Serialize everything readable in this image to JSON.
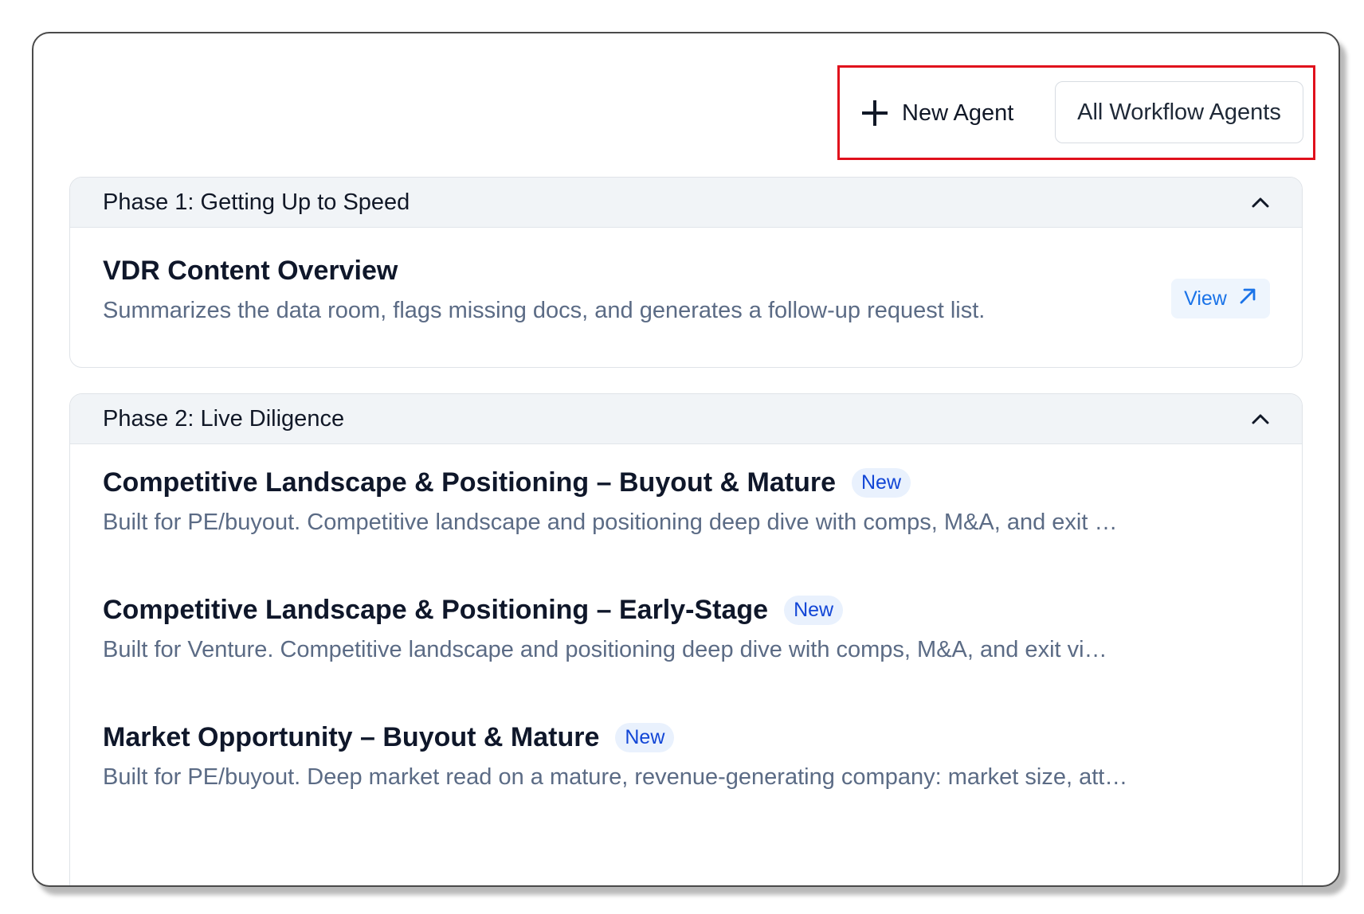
{
  "toolbar": {
    "new_agent_label": "New Agent",
    "all_agents_label": "All Workflow Agents"
  },
  "phases": [
    {
      "title": "Phase 1: Getting Up to Speed",
      "items": [
        {
          "title": "VDR Content Overview",
          "description": "Summarizes the data room, flags missing docs, and generates a follow-up request list.",
          "action_label": "View"
        }
      ]
    },
    {
      "title": "Phase 2: Live Diligence",
      "items": [
        {
          "title": "Competitive Landscape & Positioning – Buyout & Mature",
          "badge": "New",
          "description": "Built for PE/buyout. Competitive landscape and positioning deep dive with comps, M&A, and exit …"
        },
        {
          "title": "Competitive Landscape & Positioning – Early-Stage",
          "badge": "New",
          "description": "Built for Venture. Competitive landscape and positioning deep dive with comps, M&A, and exit vi…"
        },
        {
          "title": "Market Opportunity – Buyout & Mature",
          "badge": "New",
          "description": "Built for PE/buyout. Deep market read on a mature, revenue-generating company: market size, att…"
        }
      ]
    }
  ],
  "colors": {
    "highlight": "#e0101c",
    "badge_text": "#1246d6",
    "link": "#1a73e8"
  }
}
